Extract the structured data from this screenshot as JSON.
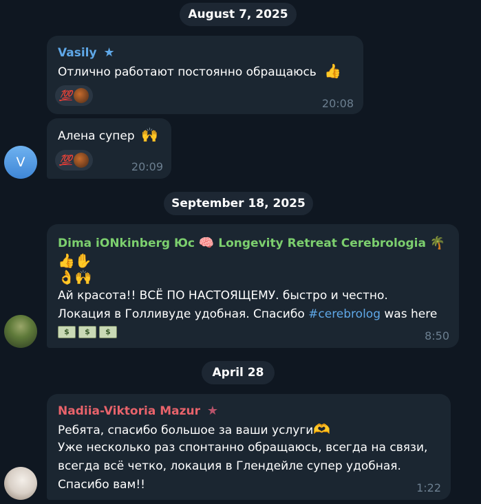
{
  "dates": {
    "d1": "August 7, 2025",
    "d2": "September 18, 2025",
    "d3": "April 28"
  },
  "messages": {
    "m1": {
      "author": "Vasily",
      "text": "Отлично работают постоянно обращаюсь",
      "time": "20:08",
      "reaction": "💯"
    },
    "m2": {
      "text": "Алена супер",
      "time": "20:09",
      "reaction": "💯",
      "avatar_letter": "V"
    },
    "m3": {
      "author": "Dima iONkinberg Юс",
      "author_suffix": "Longevity Retreat Cerebrologia",
      "line1": "Ай красота!! ВСЁ ПО НАСТОЯЩЕМУ.  быстро и  честно.",
      "line2_prefix": "Локация в Голливуде удобная. Спасибо ",
      "hashtag": "#cerebrolog",
      "line2_suffix": " was here",
      "time": "8:50"
    },
    "m4": {
      "author": "Nadiia-Viktoria Mazur",
      "line1": "Ребята, спасибо большое за ваши услуги",
      "line2": "Уже несколько раз спонтанно обращаюсь, всегда на связи,",
      "line3": "всегда всё четко, локация в Глендейле супер удобная.",
      "line4": "Спасибо вам!!",
      "time": "1:22"
    }
  },
  "colors": {
    "vasily": "#5fa8e8",
    "dima": "#7ccf6e",
    "nadiia": "#e8636b",
    "bubble": "#1b2631",
    "background": "#0f1721"
  },
  "icons": {
    "star": "star-icon",
    "thumbs_up": "thumbs-up-icon",
    "raised_hands": "raised-hands-icon",
    "brain": "brain-icon",
    "palm": "palm-tree-icon",
    "money": "money-icon",
    "ok_hand": "ok-hand-icon",
    "wave": "raised-hand-icon",
    "heart_hands": "heart-hands-icon"
  }
}
